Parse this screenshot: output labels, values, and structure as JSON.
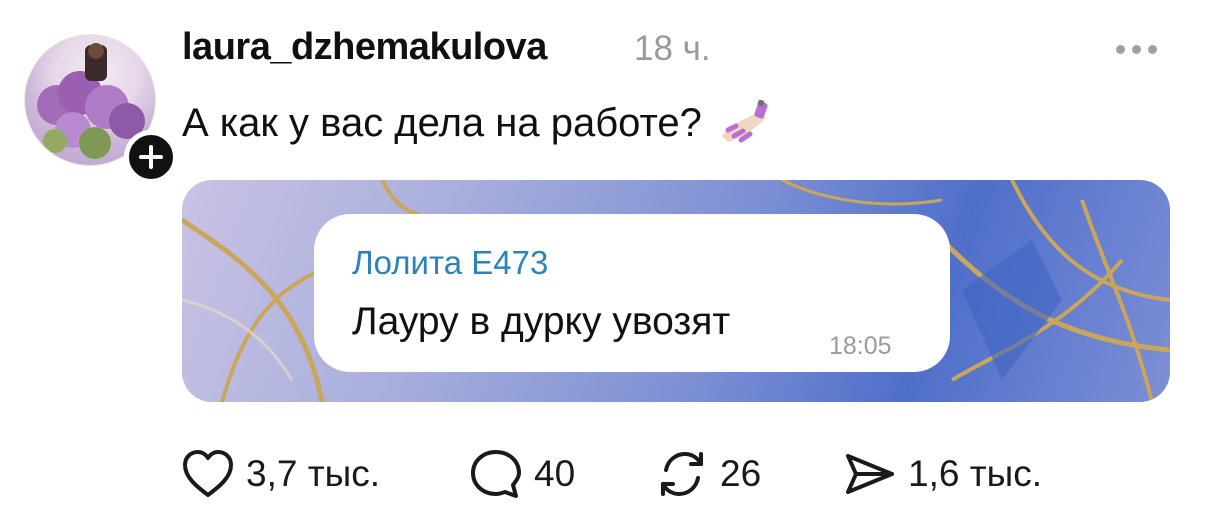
{
  "post": {
    "username": "laura_dzhemakulova",
    "time": "18 ч.",
    "text": "А как у вас дела на работе?",
    "emoji": "nail-polish-emoji"
  },
  "media": {
    "bubble": {
      "sender": "Лолита Е473",
      "message": "Лауру в дурку увозят",
      "time": "18:05"
    }
  },
  "actions": {
    "likes": "3,7 тыс.",
    "comments": "40",
    "reposts": "26",
    "shares": "1,6 тыс."
  },
  "icons": {
    "like": "heart-icon",
    "comment": "comment-bubble-icon",
    "repost": "repost-icon",
    "share": "send-icon",
    "more": "more-icon",
    "follow": "plus-icon"
  },
  "colors": {
    "sender_name": "#2a84ba",
    "muted_text": "#9a9a9a",
    "follow_badge": "#111111",
    "text": "#101010"
  }
}
